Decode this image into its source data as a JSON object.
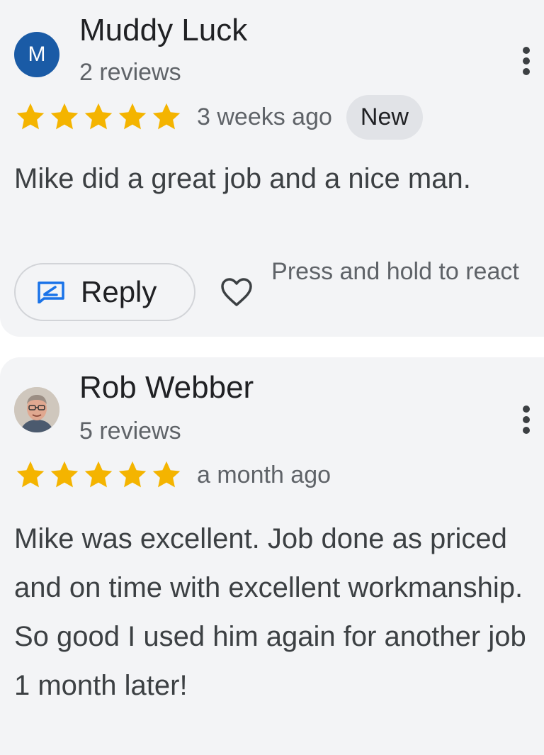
{
  "reviews": [
    {
      "avatar_letter": "M",
      "avatar_color": "#1a5ba6",
      "reviewer_name": "Muddy Luck",
      "review_count": "2 reviews",
      "rating": 5,
      "time_ago": "3 weeks ago",
      "badge": "New",
      "text": "Mike did a great job and a nice man.",
      "reply_label": "Reply",
      "react_hint": "Press and hold to react"
    },
    {
      "avatar_type": "photo",
      "reviewer_name": "Rob Webber",
      "review_count": "5 reviews",
      "rating": 5,
      "time_ago": "a month ago",
      "text": "Mike was excellent. Job done as priced and on time with excellent workmanship. So good I used him again for another job 1 month later!"
    }
  ],
  "colors": {
    "star": "#f4b400",
    "accent": "#1a73e8",
    "card_background": "#f3f4f6",
    "badge_background": "#e1e3e7"
  },
  "icons": {
    "menu": "more-vert-icon",
    "reply": "reply-icon",
    "react": "heart-icon",
    "rating": "star-icon"
  }
}
